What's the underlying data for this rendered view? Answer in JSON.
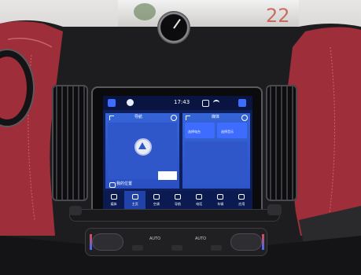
{
  "screen": {
    "status_bar": {
      "time": "17:43"
    },
    "left_panel": {
      "title": "导航",
      "location_label": "我的位置"
    },
    "right_panel": {
      "title": "媒体",
      "items": [
        "选择电台",
        "选择音乐"
      ]
    },
    "dock": [
      {
        "label": "媒体",
        "icon": "music-note-icon"
      },
      {
        "label": "主页",
        "icon": "home-icon"
      },
      {
        "label": "空调",
        "icon": "fan-icon"
      },
      {
        "label": "导航",
        "icon": "navigation-arrow-icon"
      },
      {
        "label": "电话",
        "icon": "phone-icon"
      },
      {
        "label": "车辆",
        "icon": "car-icon"
      },
      {
        "label": "应用",
        "icon": "apps-grid-icon"
      }
    ]
  },
  "climate_panel": {
    "buttons": [
      "AUTO",
      "AUTO"
    ]
  },
  "background": {
    "sign_text": "22"
  },
  "colors": {
    "screen_blue": "#2f57c9",
    "accent_blue": "#3d6cff",
    "leather_red": "#9e2f3a",
    "dash_black": "#1d1d20"
  }
}
